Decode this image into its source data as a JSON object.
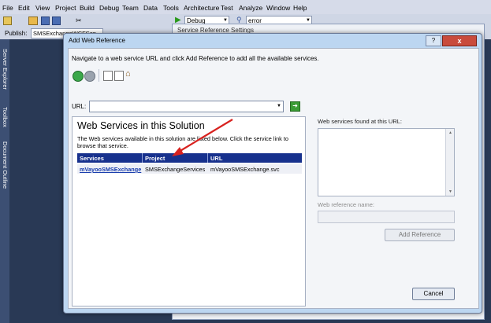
{
  "menu": [
    "File",
    "Edit",
    "View",
    "Project",
    "Build",
    "Debug",
    "Team",
    "Data",
    "Tools",
    "Architecture",
    "Test",
    "Analyze",
    "Window",
    "Help"
  ],
  "toolbar": {
    "config": "Debug",
    "find": "error",
    "publish_label": "Publish:",
    "publish_value": "SMSExchangeWCFServic"
  },
  "sidebar_tabs": [
    "Server Explorer",
    "Toolbox",
    "Document Outline"
  ],
  "background_window": {
    "title": "Service Reference Settings"
  },
  "dialog": {
    "title": "Add Web Reference",
    "help_label": "?",
    "close_label": "x",
    "instruction": "Navigate to a web service URL and click Add Reference to add all the available services.",
    "url_label": "URL:",
    "url_value": "",
    "browser": {
      "heading": "Web Services in this Solution",
      "description": "The Web services available in this solution are listed below. Click the service link to browse that service.",
      "columns": [
        "Services",
        "Project",
        "URL"
      ],
      "rows": [
        {
          "service": "mVayooSMSExchange",
          "project": "SMSExchangeServices",
          "url": "mVayooSMSExchange.svc"
        }
      ]
    },
    "found_label": "Web services found at this URL:",
    "web_reference_name_label": "Web reference name:",
    "web_reference_name_value": "",
    "add_reference_label": "Add Reference",
    "cancel_label": "Cancel"
  },
  "colors": {
    "annotation_arrow": "#d8221f",
    "table_header": "#17318d"
  }
}
